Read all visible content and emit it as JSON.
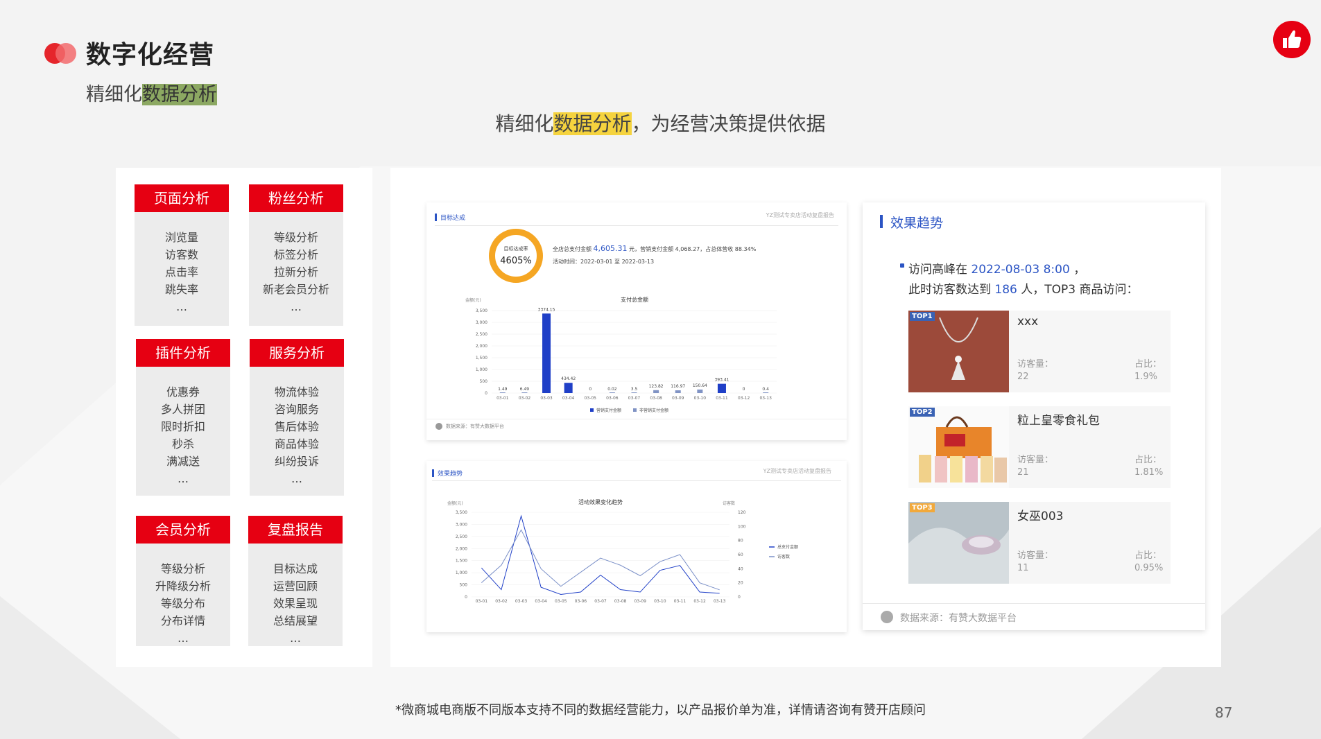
{
  "header": {
    "title": "数字化经营",
    "subtitle_plain": "精细化",
    "subtitle_highlight": "数据分析",
    "tagline_prefix": "精细化",
    "tagline_highlight": "数据分析",
    "tagline_suffix": "，为经营决策提供依据"
  },
  "brand_logo_icon": "thumbs-up-icon",
  "accent_color": "#e60012",
  "cards": [
    {
      "title": "页面分析",
      "items": [
        "浏览量",
        "访客数",
        "点击率",
        "跳失率",
        "…"
      ]
    },
    {
      "title": "粉丝分析",
      "items": [
        "等级分析",
        "标签分析",
        "拉新分析",
        "新老会员分析",
        "…"
      ]
    },
    {
      "title": "插件分析",
      "items": [
        "优惠券",
        "多人拼团",
        "限时折扣",
        "秒杀",
        "满减送",
        "…"
      ]
    },
    {
      "title": "服务分析",
      "items": [
        "物流体验",
        "咨询服务",
        "售后体验",
        "商品体验",
        "纠纷投诉",
        "…"
      ]
    },
    {
      "title": "会员分析",
      "items": [
        "等级分析",
        "升降级分析",
        "等级分布",
        "分布详情",
        "…"
      ]
    },
    {
      "title": "复盘报告",
      "items": [
        "目标达成",
        "运营回顾",
        "效果呈现",
        "总结展望",
        "…"
      ]
    }
  ],
  "target_panel": {
    "section_label": "目标达成",
    "report_name": "YZ测试专卖店活动复盘报告",
    "ring_label": "目标达成率",
    "ring_value": "4605%",
    "summary_prefix": "全店总支付金额",
    "total_amount": "4,605.31",
    "summary_rest": "元，营销支付金额 4,068.27，占总体营收 88.34%",
    "period": "活动时间：2022-03-01 至 2022-03-13",
    "source": "数据来源：有赞大数据平台"
  },
  "trend_small_panel": {
    "section_label": "效果趋势",
    "report_name": "YZ测试专卖店活动复盘报告"
  },
  "chart_data": [
    {
      "type": "bar",
      "title": "支付总金额",
      "ylabel": "金额(元)",
      "categories": [
        "03-01",
        "03-02",
        "03-03",
        "03-04",
        "03-05",
        "03-06",
        "03-07",
        "03-08",
        "03-09",
        "03-10",
        "03-11",
        "03-12",
        "03-13"
      ],
      "ylim": [
        0,
        3500
      ],
      "yticks": [
        "0",
        "500",
        "1,000",
        "1,500",
        "2,000",
        "2,500",
        "3,000",
        "3,500"
      ],
      "series": [
        {
          "name": "营销支付金额",
          "color": "#1f3fc7",
          "values": [
            0,
            0,
            3374.15,
            434.42,
            0,
            0,
            0,
            0,
            0,
            0,
            393.41,
            0,
            0
          ]
        },
        {
          "name": "非营销支付金额",
          "color": "#8093c4",
          "values": [
            1.49,
            6.49,
            0,
            0,
            0,
            0.02,
            3.5,
            123.82,
            116.97,
            150.64,
            0,
            0,
            0.4
          ]
        }
      ],
      "data_labels": [
        "1.49",
        "6.49",
        "3374.15",
        "434.42",
        "0",
        "0.02",
        "3.5",
        "123.82",
        "116.97",
        "150.64",
        "393.41",
        "0",
        "0.4"
      ],
      "legend_position": "bottom"
    },
    {
      "type": "line",
      "title": "活动效果变化趋势",
      "ylabel": "金额(元)",
      "y2label": "访客数",
      "categories": [
        "03-01",
        "03-02",
        "03-03",
        "03-04",
        "03-05",
        "03-06",
        "03-07",
        "03-08",
        "03-09",
        "03-10",
        "03-11",
        "03-12",
        "03-13"
      ],
      "ylim": [
        0,
        3500
      ],
      "yticks": [
        "0",
        "500",
        "1,000",
        "1,500",
        "2,000",
        "2,500",
        "3,000",
        "3,500"
      ],
      "y2lim": [
        0,
        120
      ],
      "y2ticks": [
        "0",
        "20",
        "40",
        "60",
        "80",
        "100",
        "120"
      ],
      "series": [
        {
          "name": "总支付金额",
          "axis": "left",
          "color": "#1f3fc7",
          "values": [
            1200,
            300,
            3350,
            400,
            100,
            200,
            900,
            300,
            200,
            1100,
            1300,
            200,
            150
          ]
        },
        {
          "name": "访客数",
          "axis": "right",
          "color": "#7b90c8",
          "values": [
            20,
            45,
            95,
            40,
            15,
            35,
            55,
            45,
            30,
            50,
            60,
            20,
            10
          ]
        }
      ],
      "legend_position": "right"
    }
  ],
  "trend_panel": {
    "title": "效果趋势",
    "line1_prefix": "访问高峰在",
    "peak_time": "2022-08-03 8:00",
    "line1_suffix": "，",
    "line2_prefix": "此时访客数达到",
    "visitors": "186",
    "line2_suffix": "人，TOP3 商品访问：",
    "visits_label": "访客量：",
    "share_label": "占比：",
    "products": [
      {
        "rank": "TOP1",
        "name": "xxx",
        "visits": "22",
        "share": "1.9%"
      },
      {
        "rank": "TOP2",
        "name": "粒上皇零食礼包",
        "visits": "21",
        "share": "1.81%"
      },
      {
        "rank": "TOP3",
        "name": "女巫003",
        "visits": "11",
        "share": "0.95%"
      }
    ],
    "source": "数据来源：有赞大数据平台"
  },
  "footer": {
    "note": "*微商城电商版不同版本支持不同的数据经营能力，以产品报价单为准，详情请咨询有赞开店顾问",
    "page_number": "87"
  }
}
